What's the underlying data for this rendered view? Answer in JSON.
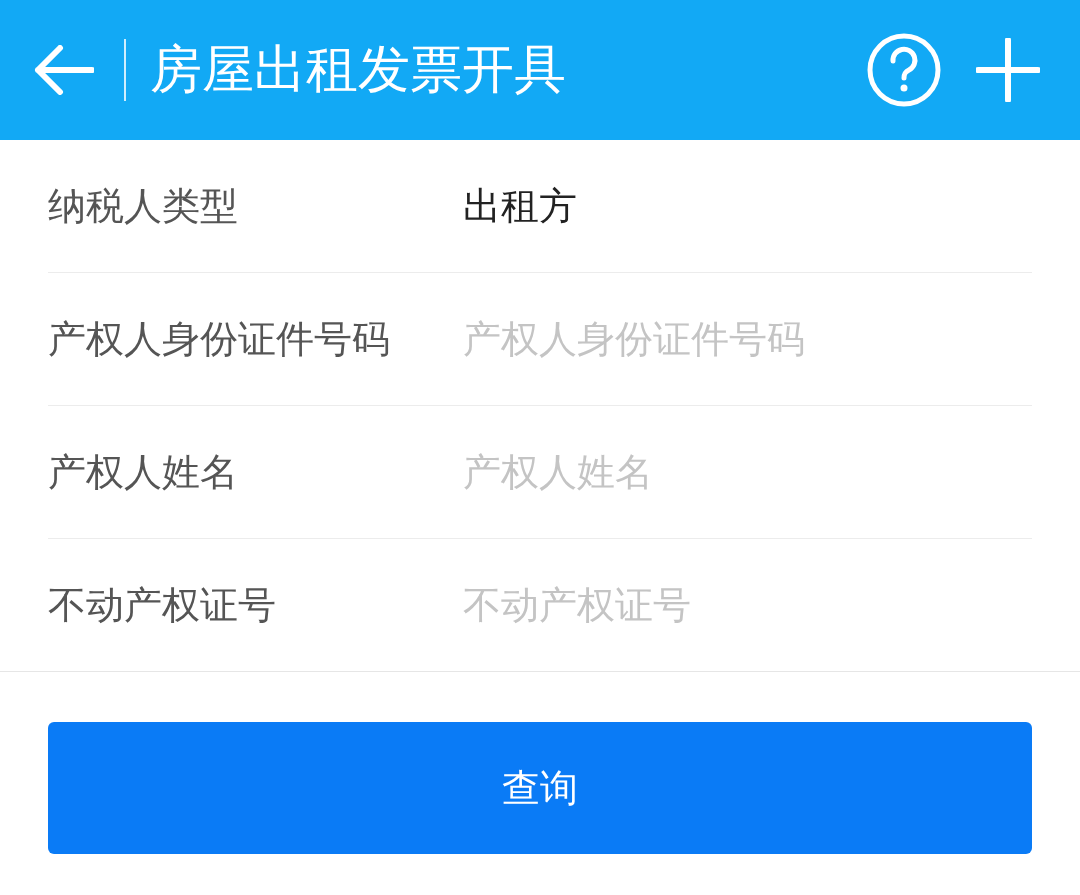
{
  "header": {
    "title": "房屋出租发票开具"
  },
  "form": [
    {
      "kind": "value",
      "label": "纳税人类型",
      "value": "出租方"
    },
    {
      "kind": "input",
      "label": "产权人身份证件号码",
      "placeholder": "产权人身份证件号码"
    },
    {
      "kind": "input",
      "label": "产权人姓名",
      "placeholder": "产权人姓名"
    },
    {
      "kind": "input",
      "label": "不动产权证号",
      "placeholder": "不动产权证号"
    }
  ],
  "submit_button": "查询"
}
